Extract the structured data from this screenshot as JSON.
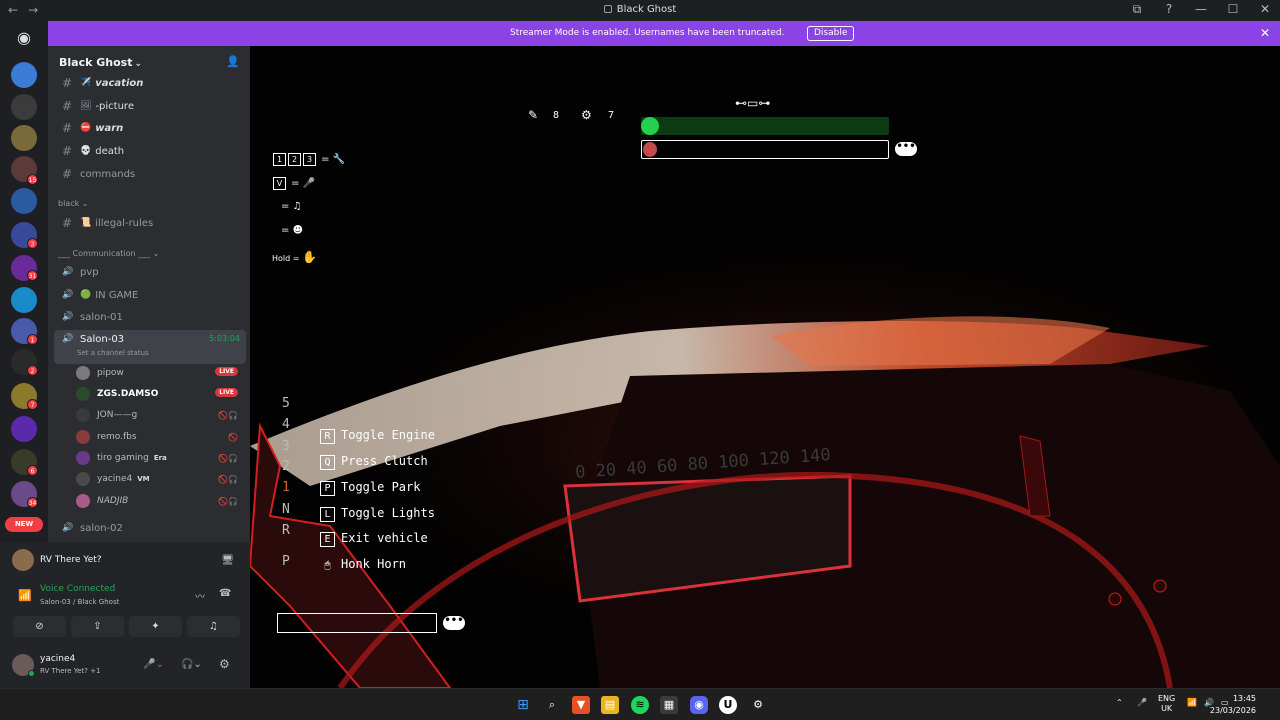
{
  "window": {
    "title": "Black Ghost",
    "controls": [
      "⧉",
      "?",
      "—",
      "☐",
      "✕"
    ]
  },
  "banner": {
    "message": "Streamer Mode is enabled. Usernames have been truncated.",
    "button": "Disable"
  },
  "rail": {
    "badges": [
      "15",
      "3",
      "31",
      "1",
      "2",
      "7",
      "6",
      "34"
    ],
    "new_label": "NEW"
  },
  "server": {
    "name": "Black Ghost",
    "channels": [
      {
        "emoji": "✈️",
        "name": "vacation"
      },
      {
        "emoji": "🖼",
        "name": "-picture"
      },
      {
        "emoji": "⛔",
        "name": "warn"
      },
      {
        "emoji": "💀",
        "name": "death"
      },
      {
        "emoji": "",
        "name": "commands"
      }
    ],
    "category_black": "black",
    "illegal_rules": "illegal-rules",
    "category_comm": "Communication",
    "voice_channels": [
      "pvp",
      "IN GAME",
      "salon-01"
    ],
    "current_voice": {
      "name": "Salon-03",
      "time": "5:03:04",
      "status": "Set a channel status"
    },
    "members": [
      {
        "name": "pipow",
        "live": "LIVE"
      },
      {
        "name": "ZGS.DAMSO",
        "live": "LIVE"
      },
      {
        "name": "JON——g",
        "live": ""
      },
      {
        "name": "remo.fbs",
        "live": ""
      },
      {
        "name": "tiro gaming",
        "tag": "Era",
        "live": ""
      },
      {
        "name": "yacine4",
        "tag": "VM",
        "live": ""
      },
      {
        "name": "NADJIB",
        "live": ""
      }
    ],
    "salon02": "salon-02"
  },
  "activity": {
    "name": "RV There Yet?"
  },
  "voice": {
    "status": "Voice Connected",
    "location": "Salon-03 / Black Ghost"
  },
  "me": {
    "name": "yacine4",
    "status": "RV There Yet? +1"
  },
  "game": {
    "pills_left": "8",
    "pills_right": "7",
    "hud_keys": [
      "1",
      "2",
      "3"
    ],
    "v_key": "V",
    "hold_label": "Hold",
    "gears": [
      "5",
      "4",
      "3",
      "2",
      "1",
      "N",
      "R",
      "P"
    ],
    "controls": [
      {
        "key": "R",
        "label": "Toggle Engine"
      },
      {
        "key": "Q",
        "label": "Press Clutch"
      },
      {
        "key": "P",
        "label": "Toggle Park"
      },
      {
        "key": "L",
        "label": "Toggle Lights"
      },
      {
        "key": "E",
        "label": "Exit vehicle"
      },
      {
        "key": "🖱",
        "label": "Honk Horn"
      }
    ],
    "speedo": "0 20 40 60 80 100 120 140"
  },
  "taskbar": {
    "lang": "ENG",
    "region": "UK",
    "time": "13:45",
    "date": "23/03/2026"
  },
  "colors": {
    "banner": "#8a44e6",
    "sidebar": "#2b2d31",
    "live": "#da373c",
    "voice_green": "#23a55a"
  }
}
